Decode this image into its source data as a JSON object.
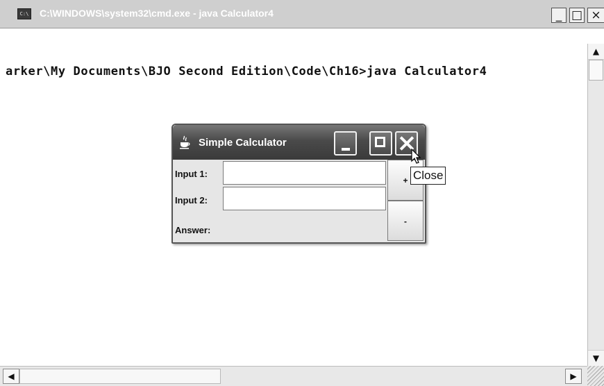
{
  "cmd_window": {
    "title": "C:\\WINDOWS\\system32\\cmd.exe - java Calculator4",
    "icon": "cmd-icon",
    "icon_text": "C:\\",
    "controls": {
      "minimize": "_",
      "maximize": "□",
      "close": "×"
    },
    "console_line": "arker\\My Documents\\BJO Second Edition\\Code\\Ch16>java Calculator4",
    "scroll": {
      "up": "▲",
      "down": "▼",
      "left": "◀",
      "right": "▶"
    }
  },
  "calculator": {
    "title": "Simple Calculator",
    "icon": "java-cup-icon",
    "labels": {
      "input1": "Input 1:",
      "input2": "Input 2:",
      "answer": "Answer:"
    },
    "inputs": {
      "input1": "",
      "input2": ""
    },
    "buttons": {
      "plus": "+",
      "minus": "-"
    }
  },
  "tooltip": "Close"
}
